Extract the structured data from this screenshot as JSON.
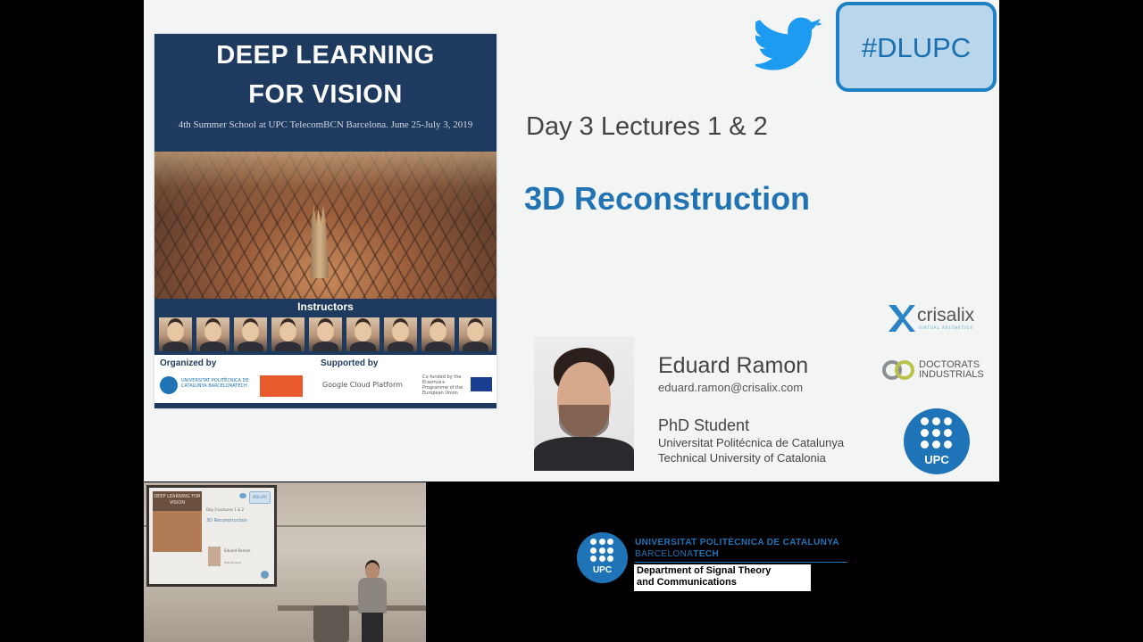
{
  "poster": {
    "title_line1": "DEEP LEARNING",
    "title_line2": "FOR VISION",
    "subtitle": "4th Summer School at UPC TelecomBCN Barcelona. June 25-July 3, 2019",
    "instructors_label": "Instructors",
    "organized_by": "Organized by",
    "supported_by": "Supported by",
    "upc_text": "UNIVERSITAT POLITÈCNICA DE CATALUNYA BARCELONATECH",
    "telecom_text": "telecom BCN",
    "google_text": "Google Cloud Platform",
    "eu_text": "Co-funded by the Erasmus+ Programme of the European Union"
  },
  "hashtag": "#DLUPC",
  "lecture": "Day 3 Lectures 1 & 2",
  "topic": "3D Reconstruction",
  "speaker": {
    "name": "Eduard Ramon",
    "email": "eduard.ramon@crisalix.com",
    "role": "PhD Student",
    "university_line1": "Universitat Politécnica de Catalunya",
    "university_line2": "Technical University of Catalonia"
  },
  "sponsors": {
    "crisalix": "crisalix",
    "crisalix_tag": "VIRTUAL AESTHETICS",
    "doctorats_line1": "DOCTORATS",
    "doctorats_line2": "INDUSTRIALS",
    "upc": "UPC"
  },
  "room_video": {
    "mini_title": "DEEP LEARNING FOR VISION",
    "mini_hashtag": "#DLUPC",
    "mini_lecture": "Day 3 Lectures 1 & 2",
    "mini_topic": "3D Reconstruction",
    "mini_speaker": "Eduard Ramon",
    "mini_role": "PhD Student"
  },
  "branding": {
    "upc": "UPC",
    "line1": "UNIVERSITAT POLITÈCNICA DE CATALUNYA",
    "line2_a": "BARCELONA",
    "line2_b": "TECH",
    "dept_line1": "Department of Signal Theory",
    "dept_line2": "and Communications"
  },
  "colors": {
    "accent": "#2173b4",
    "poster_navy": "#1e3a5f",
    "hashtag_border": "#1f7fc4"
  }
}
